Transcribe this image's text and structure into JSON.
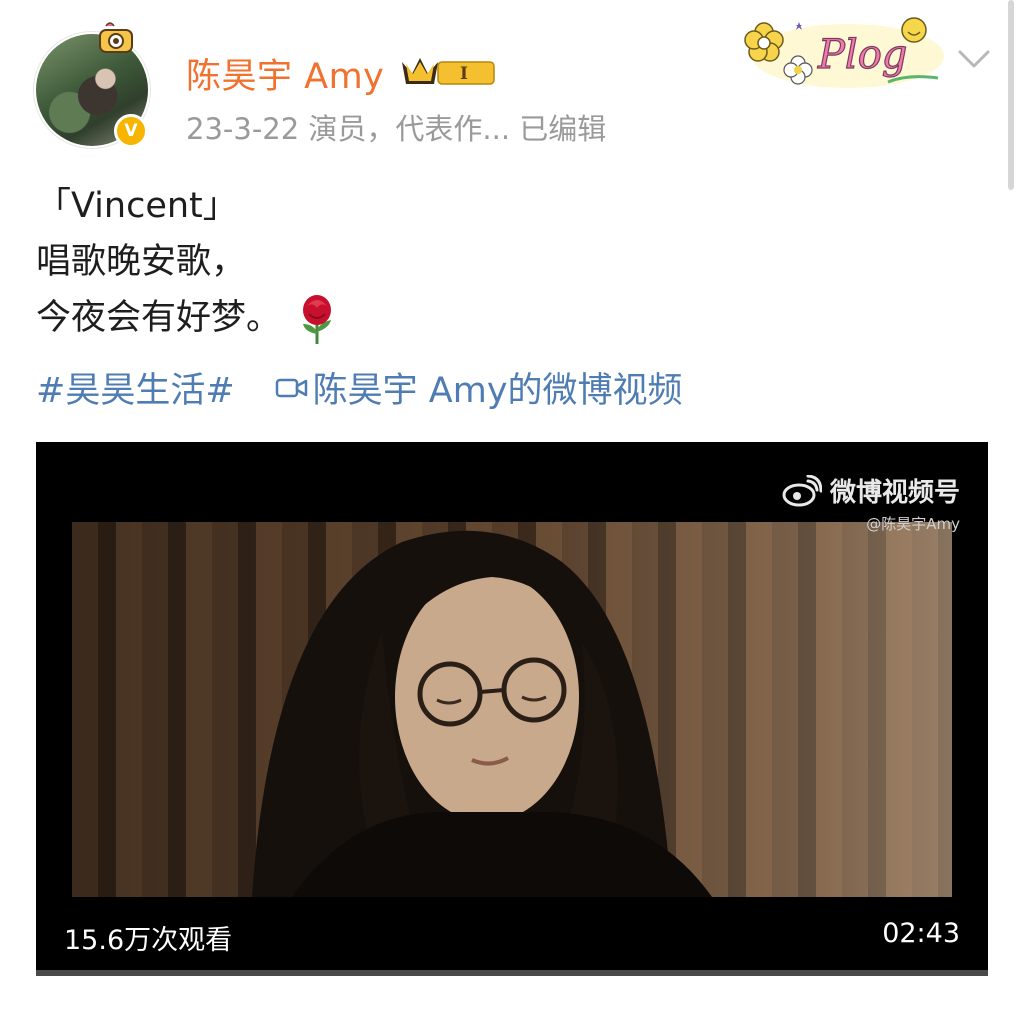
{
  "post": {
    "username": "陈昊宇 Amy",
    "level_label": "I",
    "meta": "23-3-22  演员，代表作...  已编辑",
    "sticker_text": "Plog",
    "verified_mark": "V",
    "lines": [
      "「Vincent」",
      "唱歌晚安歌，",
      "今夜会有好梦。"
    ],
    "hashtag": "#昊昊生活#",
    "video_link": "陈昊宇 Amy的微博视频"
  },
  "video": {
    "watermark_title": "微博视频号",
    "watermark_sub": "@陈昊宇Amy",
    "views": "15.6万次观看",
    "duration": "02:43",
    "progress": 0
  },
  "colors": {
    "username": "#f1722f",
    "link": "#4f7db3",
    "meta": "#9a9a9a",
    "verified": "#f7b500"
  },
  "icons": [
    "verified-icon",
    "level-crown-icon",
    "plog-sticker-icon",
    "chevron-down-icon",
    "rose-emoji-icon",
    "video-camera-icon",
    "weibo-logo-icon"
  ]
}
